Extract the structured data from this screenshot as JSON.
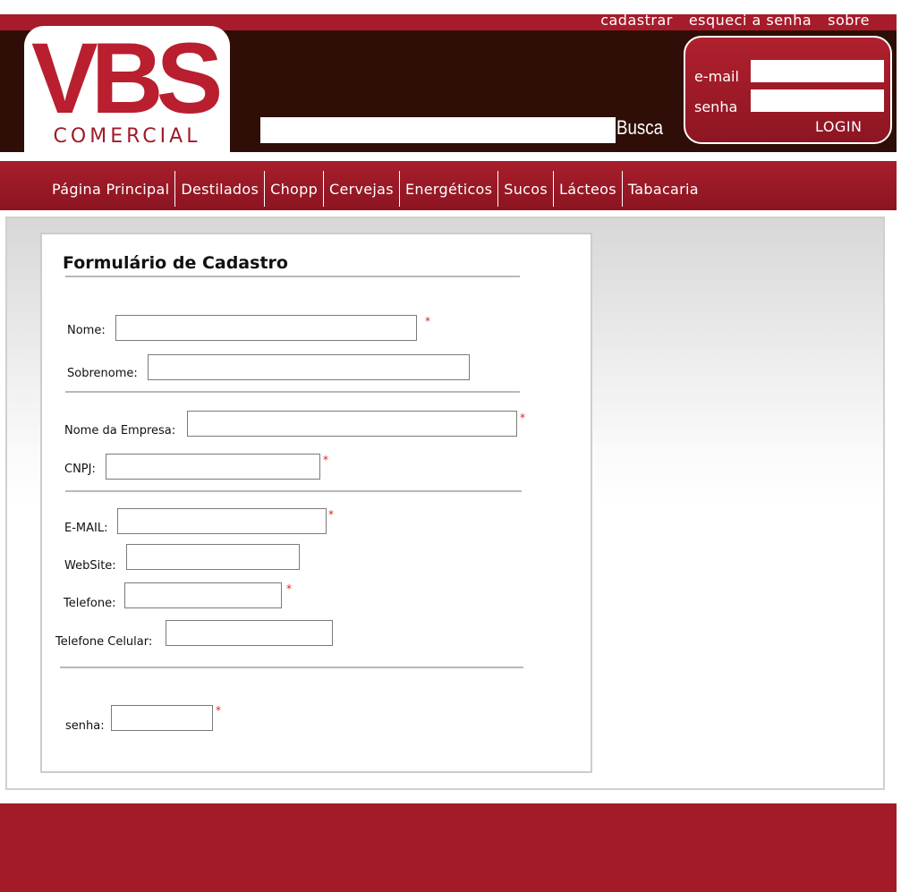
{
  "top_links": [
    "cadastrar",
    "esqueci a senha",
    "sobre"
  ],
  "logo": {
    "letters": "VBS",
    "subtitle": "COMERCIAL"
  },
  "search": {
    "label": "Busca",
    "value": ""
  },
  "login": {
    "email_label": "e-mail",
    "senha_label": "senha",
    "button": "LOGIN"
  },
  "nav": [
    "Página Principal",
    "Destilados",
    "Chopp",
    "Cervejas",
    "Energéticos",
    "Sucos",
    "Lácteos",
    "Tabacaria"
  ],
  "form": {
    "title": "Formulário de Cadastro",
    "nome": "Nome:",
    "sobrenome": "Sobrenome:",
    "empresa": "Nome da Empresa:",
    "cnpj": "CNPJ:",
    "email": "E-MAIL:",
    "website": "WebSite:",
    "telefone": "Telefone:",
    "celular": "Telefone Celular:",
    "senha": "senha:",
    "required_mark": "*"
  },
  "colors": {
    "brand_red": "#a61c2a",
    "header_dark": "#2e0e06",
    "required": "#e0201b"
  }
}
